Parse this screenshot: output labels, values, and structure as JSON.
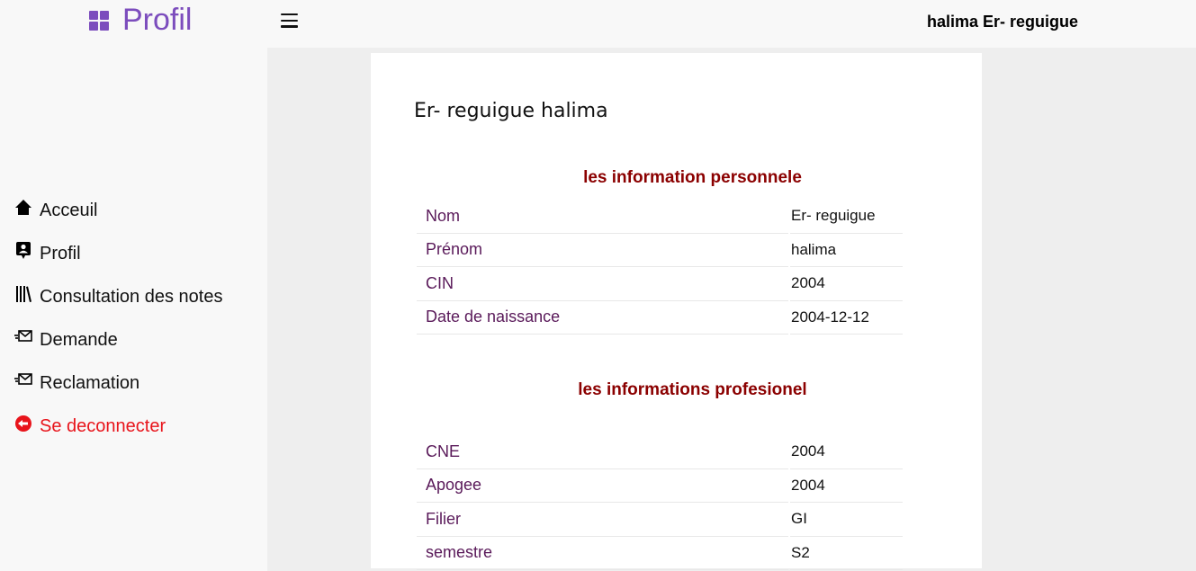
{
  "brand": {
    "title": "Profil",
    "icon": "dashboard-icon",
    "color": "#7c4dbd"
  },
  "topbar": {
    "user_name": "halima Er- reguigue",
    "menu_icon": "hamburger-icon"
  },
  "sidebar": {
    "items": [
      {
        "label": "Acceuil",
        "icon": "home-icon"
      },
      {
        "label": "Profil",
        "icon": "profile-card-icon"
      },
      {
        "label": "Consultation des notes",
        "icon": "library-icon"
      },
      {
        "label": "Demande",
        "icon": "mail-send-icon"
      },
      {
        "label": "Reclamation",
        "icon": "mail-send-icon"
      },
      {
        "label": "Se deconnecter",
        "icon": "logout-icon",
        "color": "#e8141b"
      }
    ]
  },
  "profile": {
    "full_name": "Er- reguigue halima",
    "personal": {
      "title": "les information personnele",
      "rows": [
        {
          "label": "Nom",
          "value": "Er- reguigue"
        },
        {
          "label": "Prénom",
          "value": "halima"
        },
        {
          "label": "CIN",
          "value": "2004"
        },
        {
          "label": "Date de naissance",
          "value": "2004-12-12"
        }
      ]
    },
    "professional": {
      "title": "les informations profesionel",
      "rows": [
        {
          "label": "CNE",
          "value": "2004"
        },
        {
          "label": "Apogee",
          "value": "2004"
        },
        {
          "label": "Filier",
          "value": "GI"
        },
        {
          "label": "semestre",
          "value": "S2"
        }
      ]
    }
  }
}
